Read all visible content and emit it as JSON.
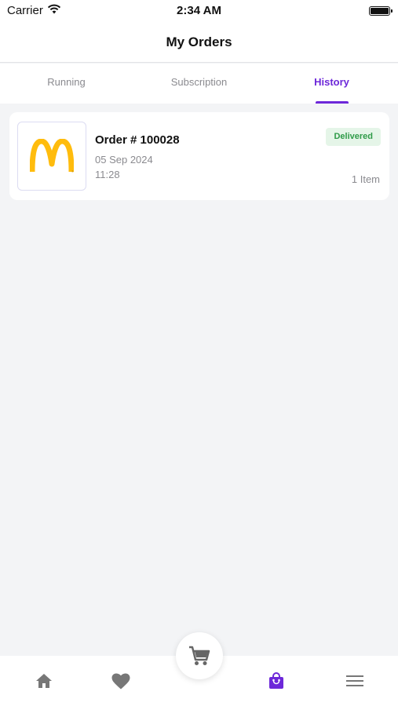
{
  "status_bar": {
    "carrier": "Carrier",
    "time": "2:34 AM"
  },
  "header": {
    "title": "My Orders"
  },
  "tabs": [
    {
      "label": "Running",
      "active": false
    },
    {
      "label": "Subscription",
      "active": false
    },
    {
      "label": "History",
      "active": true
    }
  ],
  "orders": [
    {
      "number": "Order # 100028",
      "date": "05 Sep 2024",
      "time": "11:28",
      "status": "Delivered",
      "items": "1 Item",
      "logo": "mcdonalds-logo"
    }
  ],
  "bottom_nav": {
    "items": [
      "home-icon",
      "heart-icon",
      "cart-icon",
      "shopping-bag-icon",
      "menu-icon"
    ],
    "active": "shopping-bag-icon"
  },
  "colors": {
    "accent": "#6d28d9",
    "badge_bg": "#e5f5e8",
    "badge_text": "#2f9b48",
    "background": "#f3f4f6",
    "logo_yellow": "#ffbc0d"
  }
}
